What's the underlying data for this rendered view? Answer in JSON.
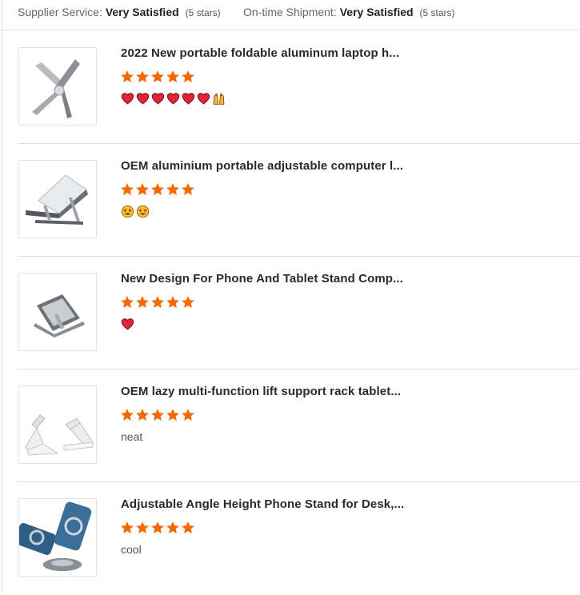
{
  "summary": {
    "supplier_label": "Supplier Service:",
    "supplier_value": "Very Satisfied",
    "supplier_stars": "(5 stars)",
    "shipment_label": "On-time Shipment:",
    "shipment_value": "Very Satisfied",
    "shipment_stars": "(5 stars)"
  },
  "colors": {
    "star": "#f56a00",
    "heart": "#e0243a",
    "divider": "#dedede"
  },
  "reviews": [
    {
      "title": "2022 New portable foldable aluminum laptop h...",
      "rating": 5,
      "emojis": [
        "red-heart",
        "red-heart",
        "red-heart",
        "red-heart",
        "red-heart",
        "red-heart",
        "raising-hands"
      ],
      "comment": "",
      "thumb_icon": "x-laptop-stand-image"
    },
    {
      "title": "OEM aluminium portable adjustable computer l...",
      "rating": 5,
      "emojis": [
        "star-struck",
        "star-struck"
      ],
      "comment": "",
      "thumb_icon": "foldable-laptop-stand-image"
    },
    {
      "title": "New Design For Phone And Tablet Stand Comp...",
      "rating": 5,
      "emojis": [
        "red-heart"
      ],
      "comment": "",
      "thumb_icon": "tablet-stand-image"
    },
    {
      "title": "OEM lazy multi-function lift support rack tablet...",
      "rating": 5,
      "emojis": [],
      "comment": "neat",
      "thumb_icon": "phone-holder-image"
    },
    {
      "title": "Adjustable Angle Height Phone Stand for Desk,...",
      "rating": 5,
      "emojis": [],
      "comment": "cool",
      "thumb_icon": "magnetic-phone-stand-image"
    }
  ]
}
